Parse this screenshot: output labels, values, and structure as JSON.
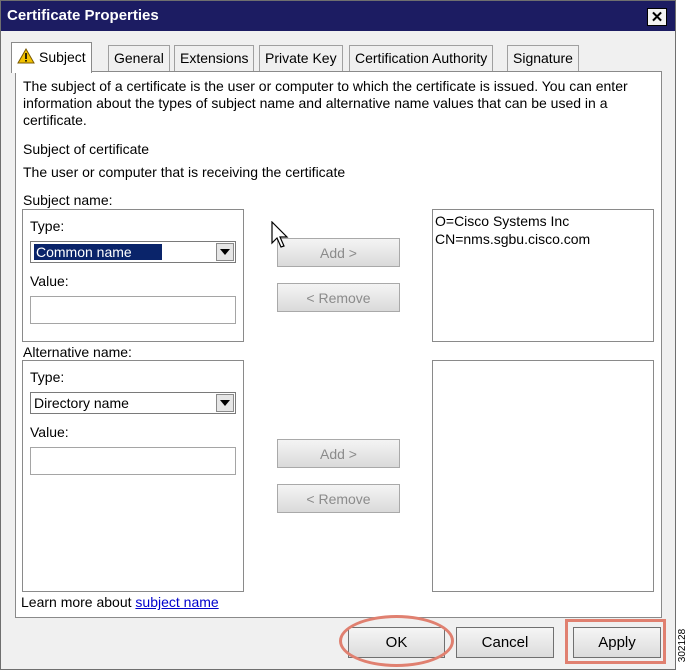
{
  "window": {
    "title": "Certificate Properties",
    "close_glyph": "✕"
  },
  "tabs": [
    {
      "label": "Subject",
      "icon": "warning-icon",
      "active": true
    },
    {
      "label": "General"
    },
    {
      "label": "Extensions"
    },
    {
      "label": "Private Key"
    },
    {
      "label": "Certification Authority"
    },
    {
      "label": "Signature"
    }
  ],
  "subject_tab": {
    "description": "The subject of a certificate is the user or computer to which the certificate is issued. You can enter information about the types of subject name and alternative name values that can be used in a certificate.",
    "section_title": "Subject of certificate",
    "section_desc": "The user or computer that is receiving the certificate",
    "subject_name": {
      "label": "Subject name:",
      "type_label": "Type:",
      "type_value": "Common name",
      "value_label": "Value:",
      "value": "",
      "add_button": "Add >",
      "remove_button": "< Remove",
      "list": [
        "O=Cisco Systems Inc",
        "CN=nms.sgbu.cisco.com"
      ]
    },
    "alternative_name": {
      "label": "Alternative name:",
      "type_label": "Type:",
      "type_value": "Directory name",
      "value_label": "Value:",
      "value": "",
      "add_button": "Add >",
      "remove_button": "< Remove",
      "list": []
    },
    "learn_more_prefix": "Learn more about ",
    "learn_more_link": "subject name"
  },
  "footer": {
    "ok": "OK",
    "cancel": "Cancel",
    "apply": "Apply"
  },
  "figure_id": "302128",
  "colors": {
    "titlebar": "#1c1c62",
    "highlight": "#0a246a",
    "callout": "#e08070",
    "link": "#0000cc"
  }
}
